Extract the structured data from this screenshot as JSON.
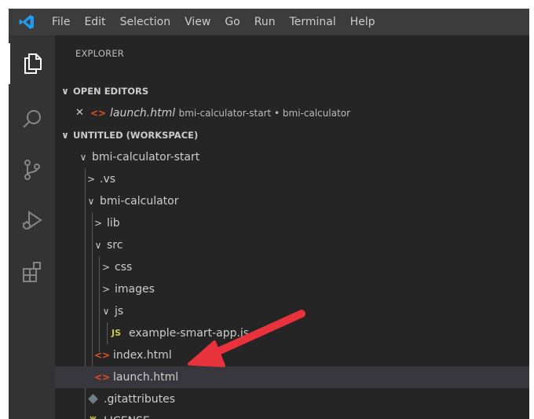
{
  "menu": [
    "File",
    "Edit",
    "Selection",
    "View",
    "Go",
    "Run",
    "Terminal",
    "Help"
  ],
  "activity_bar": [
    "explorer-icon",
    "search-icon",
    "source-control-icon",
    "run-debug-icon",
    "extensions-icon"
  ],
  "explorer": {
    "title": "EXPLORER",
    "open_editors": {
      "header": "OPEN EDITORS",
      "items": [
        {
          "name": "launch.html",
          "description": "bmi-calculator-start • bmi-calculator"
        }
      ]
    },
    "workspace": {
      "header": "UNTITLED (WORKSPACE)",
      "tree": [
        {
          "label": "bmi-calculator-start",
          "type": "folder",
          "expanded": true
        },
        {
          "label": ".vs",
          "type": "folder",
          "expanded": false
        },
        {
          "label": "bmi-calculator",
          "type": "folder",
          "expanded": true
        },
        {
          "label": "lib",
          "type": "folder",
          "expanded": false
        },
        {
          "label": "src",
          "type": "folder",
          "expanded": true
        },
        {
          "label": "css",
          "type": "folder",
          "expanded": false
        },
        {
          "label": "images",
          "type": "folder",
          "expanded": false
        },
        {
          "label": "js",
          "type": "folder",
          "expanded": true
        },
        {
          "label": "example-smart-app.js",
          "type": "js"
        },
        {
          "label": "index.html",
          "type": "html"
        },
        {
          "label": "launch.html",
          "type": "html",
          "selected": true
        },
        {
          "label": ".gitattributes",
          "type": "git"
        },
        {
          "label": "LICENSE",
          "type": "license"
        }
      ]
    }
  },
  "icons": {
    "chevron_expanded": "∨",
    "chevron_collapsed": ">",
    "html": "<>",
    "js": "JS",
    "close": "✕"
  },
  "colors": {
    "titlebar": "#3c3c3c",
    "activity_bar": "#333333",
    "sidebar": "#252526",
    "selection": "#37373d",
    "html_icon": "#e44d26",
    "js_icon": "#cbcb41",
    "annotation_arrow": "#e8323c"
  }
}
